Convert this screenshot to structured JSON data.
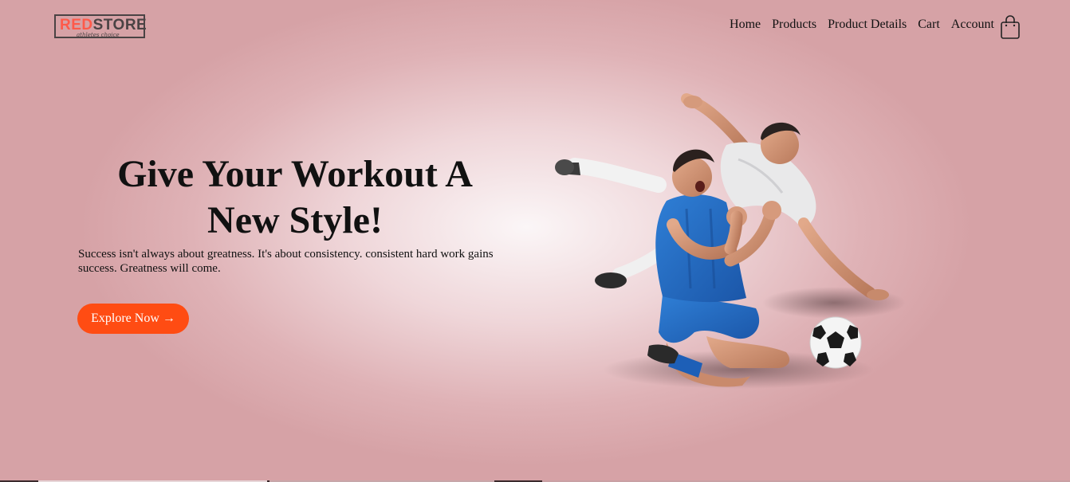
{
  "brand": {
    "logo_part1": "RED",
    "logo_part2": "STORE",
    "tagline": "athletes choice"
  },
  "nav": {
    "items": [
      {
        "label": "Home"
      },
      {
        "label": "Products"
      },
      {
        "label": "Product Details"
      },
      {
        "label": "Cart"
      },
      {
        "label": "Account"
      }
    ],
    "cart_icon": "shopping-bag-icon"
  },
  "hero": {
    "title": "Give Your Workout A New Style!",
    "description": "Success isn't always about greatness. It's about consistency. consistent hard work gains success. Greatness will come.",
    "cta_label": "Explore Now →",
    "image": "football-players-image"
  },
  "colors": {
    "accent": "#ff4c13",
    "logo_red": "#ff5a4a",
    "background_edge": "#d6a2a6",
    "background_center": "#fbf6f7"
  }
}
